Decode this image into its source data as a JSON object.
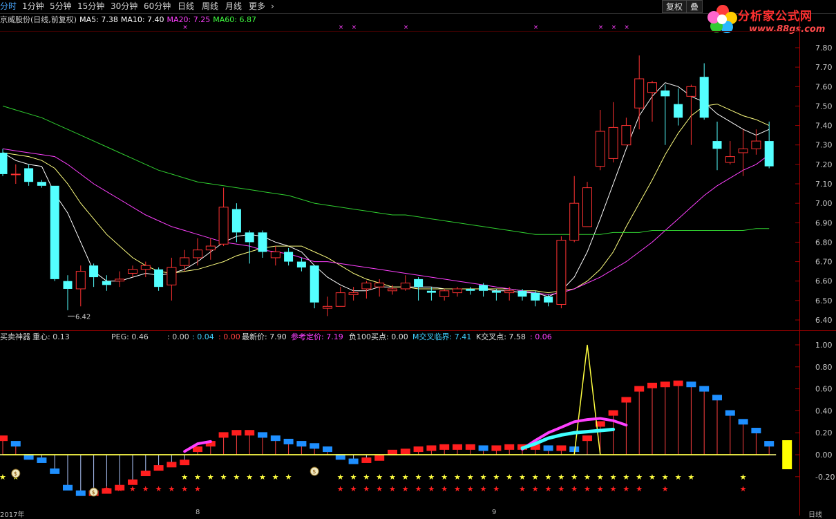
{
  "toolbar": {
    "timeframes": [
      {
        "label": "分时",
        "x": 0
      },
      {
        "label": "1分钟",
        "x": 32
      },
      {
        "label": "5分钟",
        "x": 72
      },
      {
        "label": "15分钟",
        "x": 112
      },
      {
        "label": "30分钟",
        "x": 160
      },
      {
        "label": "60分钟",
        "x": 208
      },
      {
        "label": "日线",
        "x": 257
      },
      {
        "label": "周线",
        "x": 292
      },
      {
        "label": "月线",
        "x": 326
      },
      {
        "label": "更多",
        "x": 360
      }
    ],
    "more_arrow": "›",
    "fuquan_label": "复权",
    "overlay_label": "叠"
  },
  "logo": {
    "brand": "分析家公式网",
    "url": "www.88gs.com"
  },
  "price_info": {
    "name": "京威股份(日线,前复权)",
    "ma5_label": "MA5:",
    "ma5": "7.38",
    "ma10_label": "MA10:",
    "ma10": "7.40",
    "ma20_label": "MA20:",
    "ma20": "7.25",
    "ma60_label": "MA60:",
    "ma60": "6.87"
  },
  "indicator_info": {
    "name": "买卖神器",
    "zhongxin_label": "重心:",
    "zhongxin": "0.13",
    "peg_label": "PEG:",
    "peg": "0.46",
    "v1": ": 0.00",
    "v2": ": 0.04",
    "v3": ": 0.00",
    "zuixin_label": "最新价:",
    "zuixin": "7.90",
    "cankao_label": "参考定价:",
    "cankao": "7.19",
    "fu_label": "负100买点:",
    "fu": "0.00",
    "mjiao_label": "M交叉临界:",
    "mjiao": "7.41",
    "kjiao_label": "K交叉点:",
    "kjiao": "7.58",
    "kjiao_extra": ": 0.06"
  },
  "colors": {
    "bg": "#000000",
    "up": "#ff3232",
    "down": "#54ffff",
    "ma5": "#ffffff",
    "ma10": "#ffff80",
    "ma20": "#ff40ff",
    "ma60": "#00c000",
    "grid": "#3a0000",
    "axis": "#a0a0a0"
  },
  "chart_data": {
    "type": "candlestick",
    "price_axis": {
      "ylim": [
        6.38,
        7.85
      ],
      "ticks": [
        "7.80",
        "7.70",
        "7.60",
        "7.50",
        "7.40",
        "7.30",
        "7.20",
        "7.10",
        "7.00",
        "6.90",
        "6.80",
        "6.70",
        "6.60",
        "6.50",
        "6.40"
      ]
    },
    "low_marker": "6.42",
    "candles": [
      [
        7.26,
        7.15,
        7.28,
        7.14
      ],
      [
        7.15,
        7.15,
        7.2,
        7.1
      ],
      [
        7.18,
        7.11,
        7.2,
        7.09
      ],
      [
        7.11,
        7.09,
        7.12,
        7.08
      ],
      [
        7.09,
        6.61,
        7.09,
        6.6
      ],
      [
        6.6,
        6.56,
        6.63,
        6.45
      ],
      [
        6.56,
        6.65,
        6.68,
        6.47
      ],
      [
        6.68,
        6.62,
        6.69,
        6.57
      ],
      [
        6.6,
        6.58,
        6.63,
        6.55
      ],
      [
        6.6,
        6.61,
        6.65,
        6.57
      ],
      [
        6.64,
        6.66,
        6.68,
        6.62
      ],
      [
        6.66,
        6.68,
        6.7,
        6.62
      ],
      [
        6.66,
        6.57,
        6.67,
        6.55
      ],
      [
        6.58,
        6.67,
        6.72,
        6.5
      ],
      [
        6.68,
        6.72,
        6.76,
        6.65
      ],
      [
        6.72,
        6.76,
        6.82,
        6.68
      ],
      [
        6.76,
        6.78,
        6.82,
        6.71
      ],
      [
        6.79,
        6.98,
        7.08,
        6.78
      ],
      [
        6.97,
        6.85,
        7.0,
        6.8
      ],
      [
        6.85,
        6.8,
        6.86,
        6.69
      ],
      [
        6.85,
        6.75,
        6.86,
        6.72
      ],
      [
        6.72,
        6.75,
        6.78,
        6.68
      ],
      [
        6.75,
        6.7,
        6.77,
        6.68
      ],
      [
        6.7,
        6.67,
        6.72,
        6.65
      ],
      [
        6.68,
        6.49,
        6.68,
        6.46
      ],
      [
        6.46,
        6.47,
        6.52,
        6.42
      ],
      [
        6.47,
        6.54,
        6.57,
        6.47
      ],
      [
        6.53,
        6.54,
        6.57,
        6.5
      ],
      [
        6.56,
        6.59,
        6.6,
        6.51
      ],
      [
        6.57,
        6.59,
        6.61,
        6.52
      ],
      [
        6.55,
        6.56,
        6.58,
        6.53
      ],
      [
        6.56,
        6.59,
        6.63,
        6.55
      ],
      [
        6.61,
        6.57,
        6.62,
        6.5
      ],
      [
        6.55,
        6.54,
        6.57,
        6.5
      ],
      [
        6.52,
        6.55,
        6.56,
        6.5
      ],
      [
        6.54,
        6.56,
        6.57,
        6.52
      ],
      [
        6.56,
        6.55,
        6.57,
        6.53
      ],
      [
        6.58,
        6.55,
        6.59,
        6.52
      ],
      [
        6.55,
        6.54,
        6.56,
        6.5
      ],
      [
        6.54,
        6.55,
        6.57,
        6.5
      ],
      [
        6.55,
        6.52,
        6.56,
        6.5
      ],
      [
        6.54,
        6.5,
        6.55,
        6.47
      ],
      [
        6.52,
        6.49,
        6.53,
        6.47
      ],
      [
        6.48,
        6.81,
        6.83,
        6.46
      ],
      [
        6.81,
        7.0,
        7.14,
        6.8
      ],
      [
        6.88,
        7.08,
        7.11,
        6.97
      ],
      [
        7.19,
        7.37,
        7.48,
        7.17
      ],
      [
        7.23,
        7.39,
        7.52,
        7.21
      ],
      [
        7.3,
        7.4,
        7.44,
        7.3
      ],
      [
        7.49,
        7.64,
        7.76,
        7.38
      ],
      [
        7.57,
        7.62,
        7.63,
        7.42
      ],
      [
        7.58,
        7.55,
        7.61,
        7.3
      ],
      [
        7.51,
        7.44,
        7.59,
        7.4
      ],
      [
        7.55,
        7.6,
        7.61,
        7.3
      ],
      [
        7.65,
        7.44,
        7.72,
        7.43
      ],
      [
        7.32,
        7.28,
        7.42,
        7.17
      ],
      [
        7.21,
        7.24,
        7.32,
        7.2
      ],
      [
        7.26,
        7.28,
        7.38,
        7.14
      ],
      [
        7.28,
        7.32,
        7.38,
        7.25
      ],
      [
        7.32,
        7.19,
        7.42,
        7.18
      ]
    ],
    "ma": {
      "ma5": [
        7.26,
        7.22,
        7.2,
        7.19,
        7.05,
        6.95,
        6.8,
        6.65,
        6.6,
        6.6,
        6.62,
        6.64,
        6.63,
        6.64,
        6.66,
        6.7,
        6.75,
        6.8,
        6.83,
        6.84,
        6.83,
        6.8,
        6.78,
        6.75,
        6.68,
        6.62,
        6.58,
        6.55,
        6.55,
        6.57,
        6.57,
        6.57,
        6.57,
        6.57,
        6.56,
        6.56,
        6.56,
        6.56,
        6.55,
        6.55,
        6.54,
        6.54,
        6.52,
        6.55,
        6.62,
        6.75,
        6.92,
        7.1,
        7.28,
        7.45,
        7.55,
        7.62,
        7.6,
        7.55,
        7.52,
        7.46,
        7.42,
        7.38,
        7.35,
        7.38
      ],
      "ma10": [
        7.26,
        7.25,
        7.24,
        7.22,
        7.18,
        7.1,
        7.0,
        6.92,
        6.84,
        6.78,
        6.72,
        6.68,
        6.65,
        6.64,
        6.65,
        6.66,
        6.68,
        6.7,
        6.73,
        6.75,
        6.77,
        6.78,
        6.78,
        6.78,
        6.75,
        6.72,
        6.68,
        6.64,
        6.61,
        6.59,
        6.57,
        6.57,
        6.56,
        6.56,
        6.56,
        6.56,
        6.56,
        6.56,
        6.56,
        6.56,
        6.55,
        6.55,
        6.54,
        6.55,
        6.56,
        6.6,
        6.66,
        6.75,
        6.88,
        7.0,
        7.12,
        7.25,
        7.36,
        7.45,
        7.5,
        7.51,
        7.48,
        7.45,
        7.43,
        7.4
      ],
      "ma20": [
        7.28,
        7.27,
        7.26,
        7.25,
        7.24,
        7.2,
        7.15,
        7.1,
        7.06,
        7.02,
        6.98,
        6.94,
        6.91,
        6.88,
        6.86,
        6.84,
        6.82,
        6.8,
        6.79,
        6.78,
        6.76,
        6.75,
        6.74,
        6.72,
        6.7,
        6.7,
        6.69,
        6.68,
        6.67,
        6.66,
        6.65,
        6.64,
        6.63,
        6.62,
        6.61,
        6.6,
        6.59,
        6.58,
        6.57,
        6.56,
        6.55,
        6.54,
        6.53,
        6.54,
        6.56,
        6.59,
        6.62,
        6.66,
        6.7,
        6.75,
        6.8,
        6.86,
        6.92,
        6.98,
        7.04,
        7.09,
        7.13,
        7.17,
        7.2,
        7.25
      ],
      "ma60": [
        7.5,
        7.48,
        7.46,
        7.44,
        7.41,
        7.38,
        7.35,
        7.32,
        7.29,
        7.26,
        7.23,
        7.2,
        7.17,
        7.15,
        7.13,
        7.11,
        7.1,
        7.09,
        7.08,
        7.07,
        7.06,
        7.05,
        7.04,
        7.02,
        7.0,
        6.99,
        6.98,
        6.97,
        6.96,
        6.95,
        6.94,
        6.94,
        6.93,
        6.92,
        6.91,
        6.9,
        6.89,
        6.88,
        6.87,
        6.86,
        6.85,
        6.84,
        6.84,
        6.84,
        6.84,
        6.84,
        6.84,
        6.85,
        6.85,
        6.85,
        6.86,
        6.86,
        6.86,
        6.86,
        6.86,
        6.86,
        6.86,
        6.86,
        6.87,
        6.87
      ]
    },
    "indicator_axis": {
      "ylim": [
        -0.28,
        1.05
      ],
      "ticks": [
        "1.00",
        "0.80",
        "0.60",
        "0.40",
        "0.20",
        "0.00",
        "-0.20"
      ]
    },
    "bars": [
      0.15,
      0.1,
      -0.02,
      -0.05,
      -0.15,
      -0.3,
      -0.35,
      -0.35,
      -0.33,
      -0.3,
      -0.25,
      -0.17,
      -0.12,
      -0.09,
      -0.07,
      0.05,
      0.1,
      0.18,
      0.2,
      0.2,
      0.18,
      0.15,
      0.12,
      0.1,
      0.08,
      0.05,
      -0.02,
      -0.06,
      -0.05,
      -0.03,
      0.02,
      0.03,
      0.05,
      0.06,
      0.07,
      0.07,
      0.07,
      0.06,
      0.06,
      0.07,
      0.07,
      0.07,
      0.06,
      0.06,
      0.05,
      0.15,
      0.28,
      0.38,
      0.5,
      0.6,
      0.63,
      0.64,
      0.65,
      0.64,
      0.6,
      0.52,
      0.38,
      0.3,
      0.22,
      0.1,
      -0.05,
      -0.08
    ],
    "signal": [
      0.0,
      0.0,
      0.0,
      0.0,
      0.0,
      0.0,
      0.0,
      0.0,
      0.0,
      0.0,
      0.0,
      0.0,
      0.0,
      0.0,
      0.0,
      0.0,
      0.0,
      0.0,
      0.0,
      0.0,
      0.0,
      0.0,
      0.0,
      0.0,
      0.0,
      0.0,
      0.0,
      0.0,
      0.0,
      0.0,
      0.0,
      0.0,
      0.0,
      0.0,
      0.0,
      0.0,
      0.0,
      0.0,
      0.0,
      0.0,
      0.0,
      0.0,
      0.0,
      0.0,
      0.0,
      1.0,
      0.0,
      0.0,
      0.0,
      0.0,
      0.0,
      0.0,
      0.0,
      0.0,
      0.0,
      0.0,
      0.0,
      0.0,
      0.0,
      0.0,
      0.0,
      0.0
    ],
    "magenta_curve": [
      [
        14,
        0.03
      ],
      [
        15,
        0.1
      ],
      [
        16,
        0.12
      ]
    ],
    "magenta_curve2": [
      [
        40,
        0.05
      ],
      [
        41,
        0.13
      ],
      [
        42,
        0.2
      ],
      [
        43,
        0.25
      ],
      [
        44,
        0.3
      ],
      [
        45,
        0.32
      ],
      [
        46,
        0.33
      ],
      [
        47,
        0.31
      ],
      [
        48,
        0.27
      ]
    ],
    "cyan_curve": [
      [
        40,
        0.06
      ],
      [
        41,
        0.1
      ],
      [
        42,
        0.15
      ],
      [
        43,
        0.18
      ],
      [
        44,
        0.2
      ],
      [
        45,
        0.21
      ],
      [
        46,
        0.22
      ],
      [
        47,
        0.23
      ]
    ],
    "yellow_stars_idx": [
      0,
      1,
      14,
      15,
      16,
      17,
      18,
      19,
      20,
      21,
      22,
      26,
      27,
      28,
      29,
      30,
      31,
      32,
      33,
      34,
      35,
      36,
      37,
      38,
      39,
      40,
      41,
      42,
      43,
      44,
      45,
      46,
      47,
      48,
      49,
      50,
      51,
      52,
      53,
      57
    ],
    "red_stars_idx": [
      8,
      9,
      10,
      11,
      12,
      13,
      14,
      15,
      26,
      27,
      28,
      29,
      30,
      31,
      32,
      33,
      34,
      35,
      36,
      37,
      38,
      40,
      41,
      42,
      43,
      44,
      45,
      46,
      47,
      48,
      49,
      51,
      57
    ],
    "money_bags_idx": [
      1,
      7,
      24
    ],
    "x_marks_idx": [
      14,
      26,
      27,
      31,
      41,
      46,
      47,
      48
    ],
    "date_labels": [
      "2017年",
      "8",
      "9"
    ]
  },
  "footer": {
    "right_label": "日线"
  }
}
